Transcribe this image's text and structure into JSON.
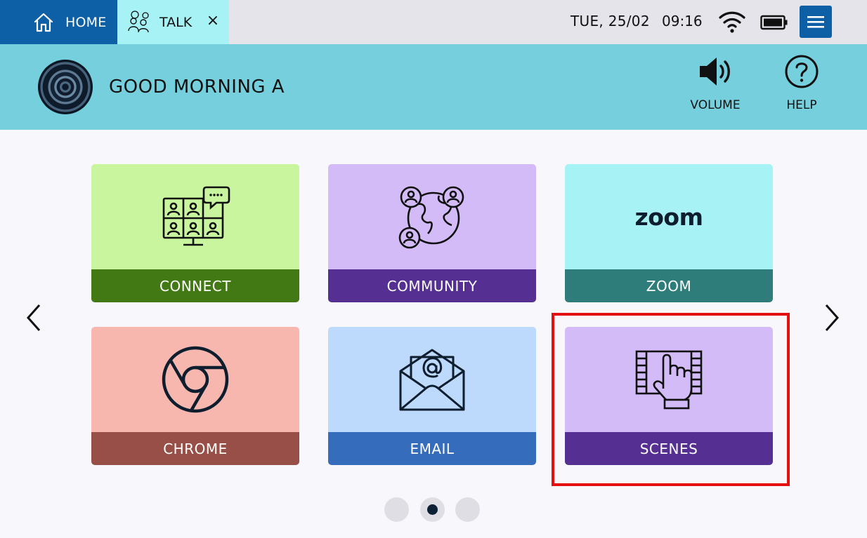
{
  "tabs": {
    "home_label": "HOME",
    "talk_label": "TALK",
    "close_symbol": "×"
  },
  "status": {
    "date": "TUE,  25/02",
    "time": "09:16"
  },
  "header": {
    "greeting": "GOOD MORNING A",
    "volume_label": "VOLUME",
    "help_label": "HELP"
  },
  "tiles": [
    {
      "label": "CONNECT",
      "icon": "video-call-icon"
    },
    {
      "label": "COMMUNITY",
      "icon": "globe-people-icon"
    },
    {
      "label": "ZOOM",
      "icon": "zoom-logo",
      "logo_text": "zoom"
    },
    {
      "label": "CHROME",
      "icon": "chrome-icon"
    },
    {
      "label": "EMAIL",
      "icon": "email-icon"
    },
    {
      "label": "SCENES",
      "icon": "film-hand-icon"
    }
  ],
  "pager": {
    "count": 3,
    "active": 2
  },
  "colors": {
    "home_tab": "#0d5fa6",
    "header": "#76cfdc",
    "highlight": "#e50f0f"
  }
}
